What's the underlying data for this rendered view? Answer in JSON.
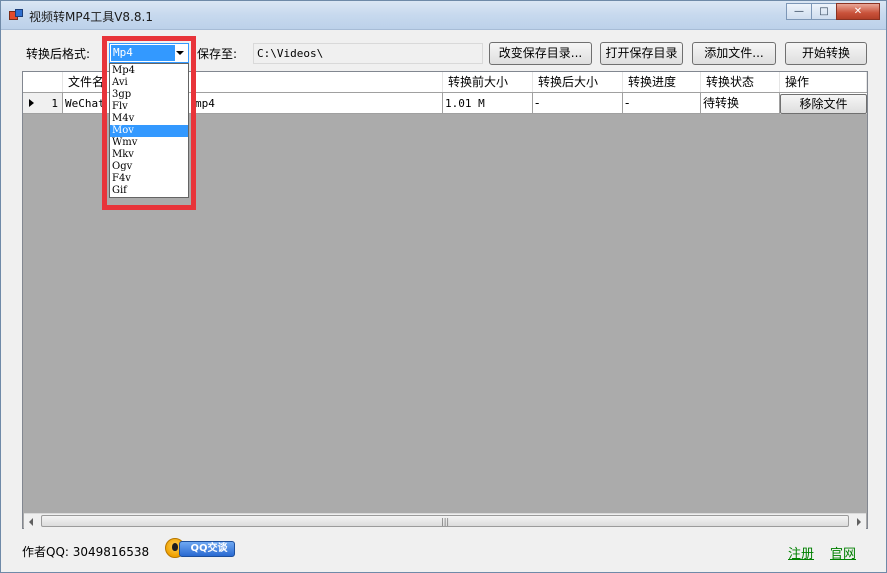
{
  "window": {
    "title": "视频转MP4工具V8.8.1",
    "minimize": "—",
    "maximize": "□",
    "close": "✕"
  },
  "toolbar": {
    "format_label": "转换后格式:",
    "format_value": "Mp4",
    "save_label": "保存至:",
    "save_path": "C:\\Videos\\",
    "change_dir_label": "改变保存目录...",
    "open_dir_label": "打开保存目录",
    "add_file_label": "添加文件...",
    "start_label": "开始转换"
  },
  "format_options": [
    "Mp4",
    "Avi",
    "3gp",
    "Flv",
    "M4v",
    "Mov",
    "Wmv",
    "Mkv",
    "Ogv",
    "F4v",
    "Gif"
  ],
  "format_highlighted": "Mov",
  "grid": {
    "columns": [
      "文件名",
      "转换前大小",
      "转换后大小",
      "转换进度",
      "转换状态",
      "操作"
    ],
    "rows": [
      {
        "index": "1",
        "name_start": "WeChat",
        "name_end": "mp4",
        "size_before": "1.01 M",
        "size_after": "-",
        "progress": "-",
        "status": "待转换",
        "action": "移除文件"
      }
    ],
    "scroll_grip": "|||"
  },
  "footer": {
    "author": "作者QQ: 3049816538",
    "qq_badge": "QQ交谈",
    "register": "注册",
    "website": "官网"
  }
}
